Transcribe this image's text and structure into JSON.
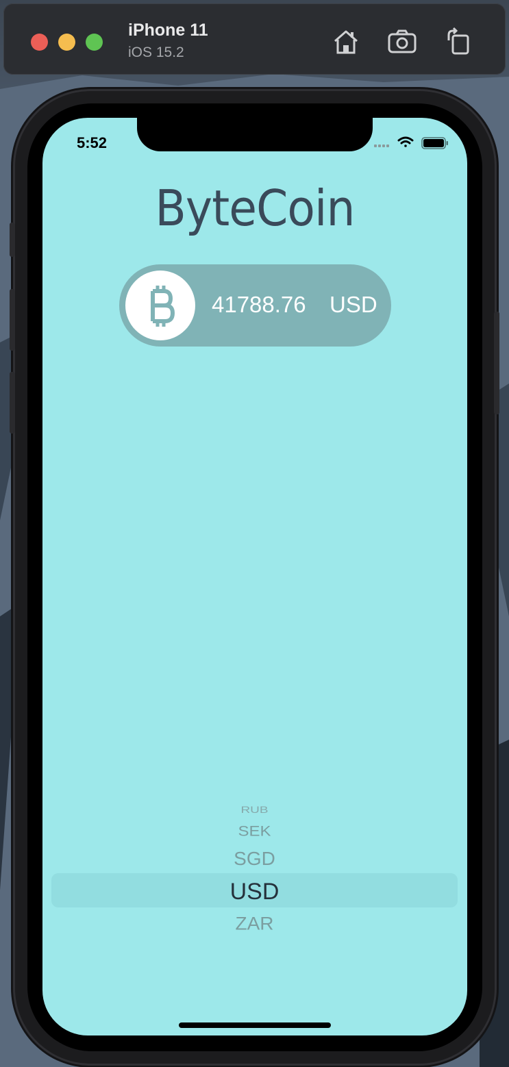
{
  "titlebar": {
    "device_name": "iPhone 11",
    "os_version": "iOS 15.2",
    "buttons": [
      "home-icon",
      "screenshot-icon",
      "rotate-icon"
    ]
  },
  "status_bar": {
    "time": "5:52",
    "icons": [
      "signal-icon",
      "wifi-icon",
      "battery-icon"
    ]
  },
  "app": {
    "title": "ByteCoin",
    "coin_icon": "bitcoin-icon",
    "price_value": "41788.76",
    "price_currency": "USD"
  },
  "picker": {
    "rows": [
      "RUB",
      "SEK",
      "SGD",
      "USD",
      "ZAR"
    ],
    "selected": "USD"
  },
  "colors": {
    "background": "#9de8ea",
    "pill": "#80b3b6",
    "title": "#3a4a5a"
  }
}
